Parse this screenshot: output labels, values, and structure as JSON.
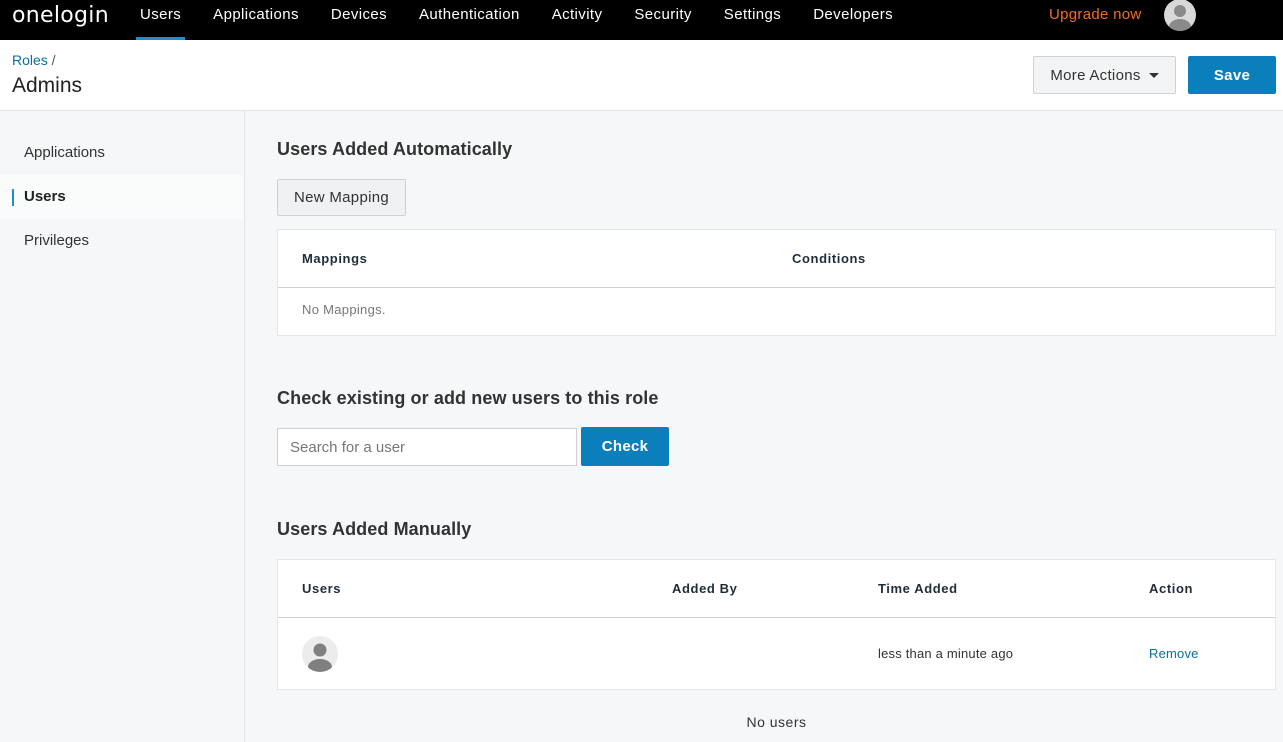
{
  "topnav": {
    "logo": "onelogin",
    "items": [
      {
        "label": "Users",
        "active": true
      },
      {
        "label": "Applications"
      },
      {
        "label": "Devices"
      },
      {
        "label": "Authentication"
      },
      {
        "label": "Activity"
      },
      {
        "label": "Security"
      },
      {
        "label": "Settings"
      },
      {
        "label": "Developers"
      }
    ],
    "upgrade": "Upgrade now"
  },
  "header": {
    "breadcrumb_parent": "Roles",
    "breadcrumb_sep": " /",
    "title": "Admins",
    "more_actions": "More Actions",
    "save": "Save"
  },
  "sidebar": {
    "items": [
      {
        "label": "Applications"
      },
      {
        "label": "Users",
        "active": true
      },
      {
        "label": "Privileges"
      }
    ]
  },
  "auto": {
    "title": "Users Added Automatically",
    "new_mapping": "New Mapping",
    "columns": [
      "Mappings",
      "Conditions"
    ],
    "empty": "No Mappings."
  },
  "check": {
    "title": "Check existing or add new users to this role",
    "placeholder": "Search for a user",
    "value": "",
    "button": "Check"
  },
  "manual": {
    "title": "Users Added Manually",
    "columns": [
      "Users",
      "Added By",
      "Time Added",
      "Action"
    ],
    "rows": [
      {
        "user": "",
        "added_by": "",
        "time_added": "less than a minute ago",
        "action": "Remove"
      }
    ],
    "footer": "No users"
  },
  "colors": {
    "accent": "#0b7fbb",
    "upgrade": "#f26c23",
    "nav_bg": "#000000"
  }
}
